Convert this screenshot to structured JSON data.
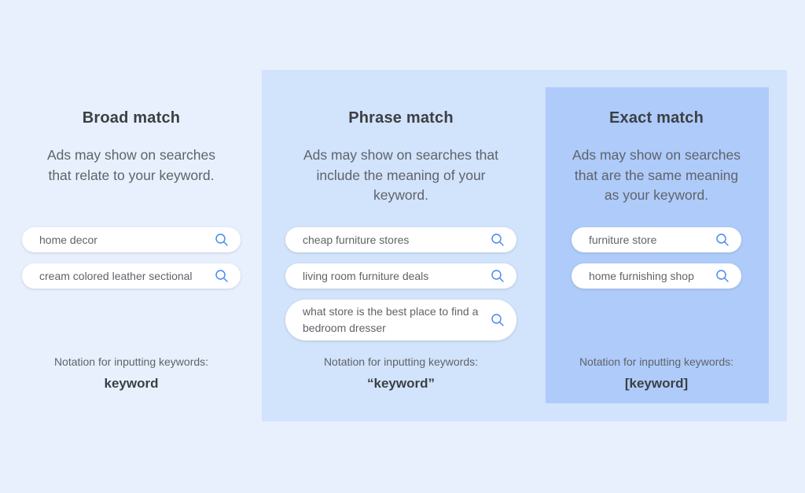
{
  "columns": [
    {
      "title": "Broad match",
      "description": "Ads may show on searches that relate to your keyword.",
      "searches": [
        "home decor",
        "cream colored leather sectional"
      ],
      "notation_label": "Notation for inputting keywords:",
      "notation_value": "keyword"
    },
    {
      "title": "Phrase match",
      "description": "Ads may show on searches that include the meaning of your keyword.",
      "searches": [
        "cheap furniture stores",
        "living room furniture deals",
        "what store is the best place to find a bedroom dresser"
      ],
      "notation_label": "Notation for inputting keywords:",
      "notation_value": "“keyword”"
    },
    {
      "title": "Exact match",
      "description": "Ads may show on searches that are the same meaning as your keyword.",
      "searches": [
        "furniture store",
        "home furnishing shop"
      ],
      "notation_label": "Notation for inputting keywords:",
      "notation_value": "[keyword]"
    }
  ],
  "icons": {
    "search": "search-icon"
  },
  "colors": {
    "background": "#e8f0fe",
    "phrase_panel": "#d2e3fc",
    "exact_panel": "#aecbfa",
    "icon_blue": "#4285f4"
  }
}
